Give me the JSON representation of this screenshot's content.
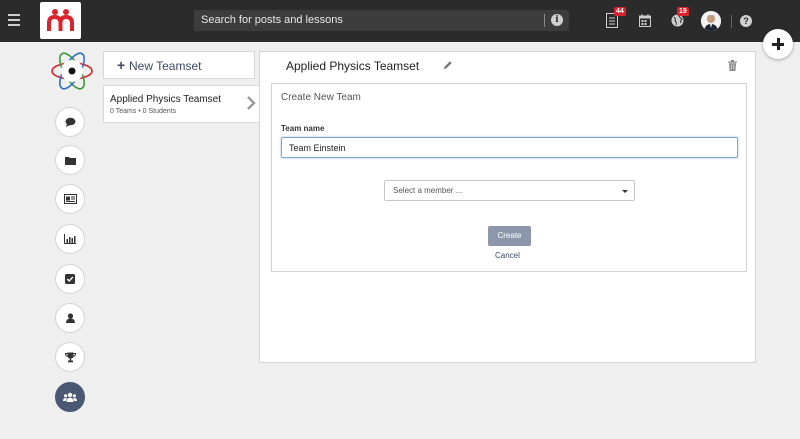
{
  "topbar": {
    "search_placeholder": "Search for posts and lessons",
    "notifications": {
      "assignments_badge": "44",
      "global_badge": "19"
    },
    "icons": [
      "menu-icon",
      "info-icon",
      "assignments-icon",
      "calendar-icon",
      "globe-icon",
      "help-icon",
      "plus-icon"
    ]
  },
  "sidebar": {
    "items": [
      {
        "icon": "chat-icon"
      },
      {
        "icon": "folder-icon"
      },
      {
        "icon": "news-icon"
      },
      {
        "icon": "chart-icon"
      },
      {
        "icon": "checkbox-icon"
      },
      {
        "icon": "user-icon"
      },
      {
        "icon": "trophy-icon"
      },
      {
        "icon": "group-icon",
        "active": true
      }
    ]
  },
  "teamsets": {
    "new_label": "New Teamset",
    "items": [
      {
        "name": "Applied Physics Teamset",
        "meta": "0 Teams • 0 Students"
      }
    ]
  },
  "main": {
    "title": "Applied Physics Teamset",
    "form": {
      "heading": "Create New Team",
      "team_name_label": "Team name",
      "team_name_value": "Team Einstein",
      "member_placeholder": "Select a member ...",
      "create_label": "Create",
      "cancel_label": "Cancel"
    }
  },
  "colors": {
    "topbar": "#2b2b2b",
    "accent": "#3c4a66",
    "badge": "#d9232d",
    "active_rail": "#4a5873",
    "create_button": "#8d97ab"
  }
}
